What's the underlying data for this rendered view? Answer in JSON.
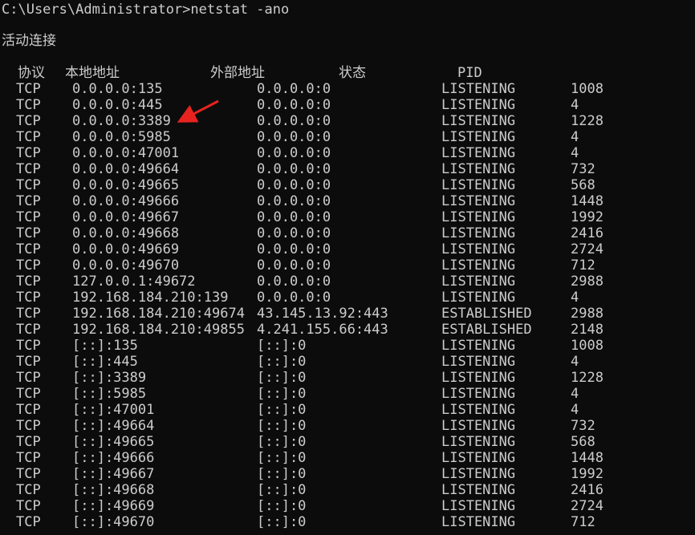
{
  "terminal": {
    "prompt_line": "C:\\Users\\Administrator>netstat -ano",
    "section_title": "活动连接",
    "headers": {
      "proto": "协议",
      "local": "本地地址",
      "foreign": "外部地址",
      "state": "状态",
      "pid": "PID"
    },
    "connections": [
      {
        "proto": "TCP",
        "local": "0.0.0.0:135",
        "foreign": "0.0.0.0:0",
        "state": "LISTENING",
        "pid": "1008"
      },
      {
        "proto": "TCP",
        "local": "0.0.0.0:445",
        "foreign": "0.0.0.0:0",
        "state": "LISTENING",
        "pid": "4"
      },
      {
        "proto": "TCP",
        "local": "0.0.0.0:3389",
        "foreign": "0.0.0.0:0",
        "state": "LISTENING",
        "pid": "1228"
      },
      {
        "proto": "TCP",
        "local": "0.0.0.0:5985",
        "foreign": "0.0.0.0:0",
        "state": "LISTENING",
        "pid": "4"
      },
      {
        "proto": "TCP",
        "local": "0.0.0.0:47001",
        "foreign": "0.0.0.0:0",
        "state": "LISTENING",
        "pid": "4"
      },
      {
        "proto": "TCP",
        "local": "0.0.0.0:49664",
        "foreign": "0.0.0.0:0",
        "state": "LISTENING",
        "pid": "732"
      },
      {
        "proto": "TCP",
        "local": "0.0.0.0:49665",
        "foreign": "0.0.0.0:0",
        "state": "LISTENING",
        "pid": "568"
      },
      {
        "proto": "TCP",
        "local": "0.0.0.0:49666",
        "foreign": "0.0.0.0:0",
        "state": "LISTENING",
        "pid": "1448"
      },
      {
        "proto": "TCP",
        "local": "0.0.0.0:49667",
        "foreign": "0.0.0.0:0",
        "state": "LISTENING",
        "pid": "1992"
      },
      {
        "proto": "TCP",
        "local": "0.0.0.0:49668",
        "foreign": "0.0.0.0:0",
        "state": "LISTENING",
        "pid": "2416"
      },
      {
        "proto": "TCP",
        "local": "0.0.0.0:49669",
        "foreign": "0.0.0.0:0",
        "state": "LISTENING",
        "pid": "2724"
      },
      {
        "proto": "TCP",
        "local": "0.0.0.0:49670",
        "foreign": "0.0.0.0:0",
        "state": "LISTENING",
        "pid": "712"
      },
      {
        "proto": "TCP",
        "local": "127.0.0.1:49672",
        "foreign": "0.0.0.0:0",
        "state": "LISTENING",
        "pid": "2988"
      },
      {
        "proto": "TCP",
        "local": "192.168.184.210:139",
        "foreign": "0.0.0.0:0",
        "state": "LISTENING",
        "pid": "4"
      },
      {
        "proto": "TCP",
        "local": "192.168.184.210:49674",
        "foreign": "43.145.13.92:443",
        "state": "ESTABLISHED",
        "pid": "2988"
      },
      {
        "proto": "TCP",
        "local": "192.168.184.210:49855",
        "foreign": "4.241.155.66:443",
        "state": "ESTABLISHED",
        "pid": "2148"
      },
      {
        "proto": "TCP",
        "local": "[::]:135",
        "foreign": "[::]:0",
        "state": "LISTENING",
        "pid": "1008"
      },
      {
        "proto": "TCP",
        "local": "[::]:445",
        "foreign": "[::]:0",
        "state": "LISTENING",
        "pid": "4"
      },
      {
        "proto": "TCP",
        "local": "[::]:3389",
        "foreign": "[::]:0",
        "state": "LISTENING",
        "pid": "1228"
      },
      {
        "proto": "TCP",
        "local": "[::]:5985",
        "foreign": "[::]:0",
        "state": "LISTENING",
        "pid": "4"
      },
      {
        "proto": "TCP",
        "local": "[::]:47001",
        "foreign": "[::]:0",
        "state": "LISTENING",
        "pid": "4"
      },
      {
        "proto": "TCP",
        "local": "[::]:49664",
        "foreign": "[::]:0",
        "state": "LISTENING",
        "pid": "732"
      },
      {
        "proto": "TCP",
        "local": "[::]:49665",
        "foreign": "[::]:0",
        "state": "LISTENING",
        "pid": "568"
      },
      {
        "proto": "TCP",
        "local": "[::]:49666",
        "foreign": "[::]:0",
        "state": "LISTENING",
        "pid": "1448"
      },
      {
        "proto": "TCP",
        "local": "[::]:49667",
        "foreign": "[::]:0",
        "state": "LISTENING",
        "pid": "1992"
      },
      {
        "proto": "TCP",
        "local": "[::]:49668",
        "foreign": "[::]:0",
        "state": "LISTENING",
        "pid": "2416"
      },
      {
        "proto": "TCP",
        "local": "[::]:49669",
        "foreign": "[::]:0",
        "state": "LISTENING",
        "pid": "2724"
      },
      {
        "proto": "TCP",
        "local": "[::]:49670",
        "foreign": "[::]:0",
        "state": "LISTENING",
        "pid": "712"
      }
    ]
  },
  "annotation": {
    "icon": "red-arrow-icon",
    "points_to": "0.0.0.0:3389",
    "color": "#e8231f"
  },
  "colors": {
    "background": "#0c0c0c",
    "text": "#cccccc"
  }
}
